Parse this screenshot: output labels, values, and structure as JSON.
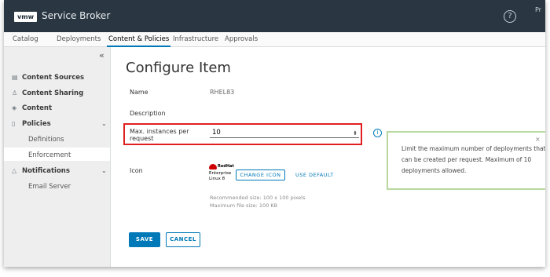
{
  "header": {
    "logo": "vmw",
    "app_title": "Service Broker",
    "help_glyph": "?",
    "truncated_text": "Pr"
  },
  "tabs": [
    {
      "label": "Catalog"
    },
    {
      "label": "Deployments"
    },
    {
      "label": "Content & Policies",
      "active": true
    },
    {
      "label": "Infrastructure"
    },
    {
      "label": "Approvals"
    }
  ],
  "sidebar": {
    "collapse_glyph": "«",
    "items": [
      {
        "label": "Content Sources",
        "icon": "content-sources-icon"
      },
      {
        "label": "Content Sharing",
        "icon": "content-sharing-icon"
      },
      {
        "label": "Content",
        "icon": "content-icon",
        "active": true
      },
      {
        "label": "Policies",
        "icon": "policies-icon"
      },
      {
        "label": "Definitions"
      },
      {
        "label": "Enforcement"
      },
      {
        "label": "Notifications",
        "icon": "bell-icon"
      },
      {
        "label": "Email Server"
      }
    ]
  },
  "main": {
    "title": "Configure Item",
    "name_label": "Name",
    "name_value": "RHEL83",
    "description_label": "Description",
    "max_label": "Max. instances per request",
    "max_value": "10",
    "icon_label": "Icon",
    "change_icon": "CHANGE ICON",
    "use_default": "USE DEFAULT",
    "hint_size": "Recommended size: 100 x 100 pixels",
    "hint_file": "Maximum file size: 100 KB",
    "save": "SAVE",
    "cancel": "CANCEL",
    "logo_text_top": "RedHat",
    "logo_text_bottom": "Enterprise Linux 8"
  },
  "tooltip": {
    "text": "Limit the maximum number of deployments that can be created per request. Maximum of 10 deployments allowed.",
    "close": "×"
  },
  "colors": {
    "topbar": "#2a3742",
    "accent": "#0079b8",
    "highlight": "#e02020",
    "tooltip_border": "#b8d8a0"
  }
}
